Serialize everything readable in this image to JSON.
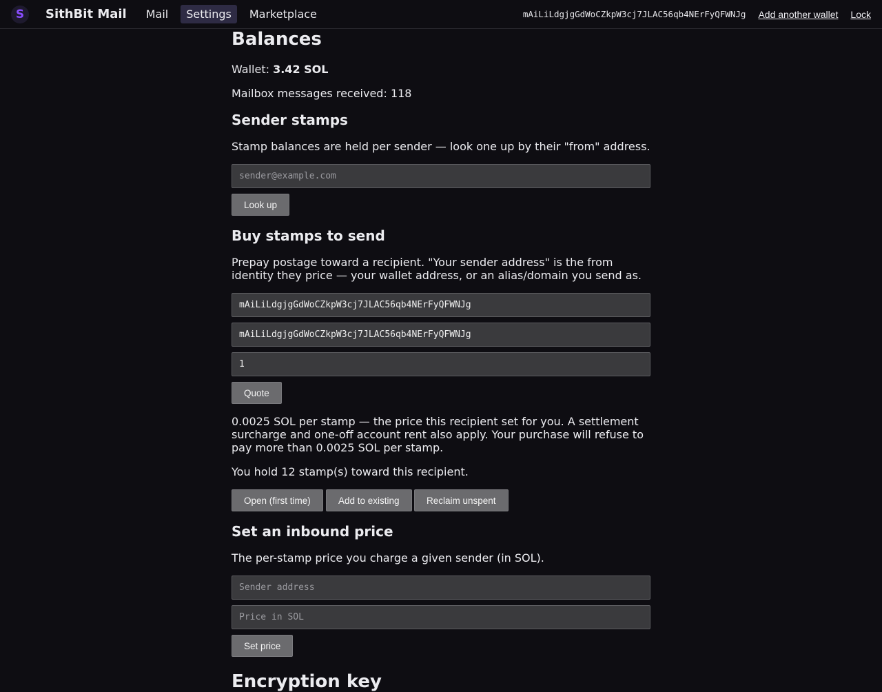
{
  "header": {
    "logo_letter": "S",
    "brand": "SithBit Mail",
    "nav": [
      "Mail",
      "Settings",
      "Marketplace"
    ],
    "wallet_address": "mAiLiLdgjgGdWoCZkpW3cj7JLAC56qb4NErFyQFWNJg",
    "add_wallet_label": "Add another wallet",
    "lock_label": "Lock"
  },
  "balances": {
    "heading": "Balances",
    "wallet_label": "Wallet: ",
    "wallet_value": "3.42 SOL",
    "mailbox_text": "Mailbox messages received: 118"
  },
  "sender_stamps": {
    "heading": "Sender stamps",
    "description": "Stamp balances are held per sender — look one up by their \"from\" address.",
    "input_placeholder": "sender@example.com",
    "button": "Look up"
  },
  "buy_stamps": {
    "heading": "Buy stamps to send",
    "description": "Prepay postage toward a recipient. \"Your sender address\" is the from identity they price — your wallet address, or an alias/domain you send as.",
    "recipient_value": "mAiLiLdgjgGdWoCZkpW3cj7JLAC56qb4NErFyQFWNJg",
    "sender_value": "mAiLiLdgjgGdWoCZkpW3cj7JLAC56qb4NErFyQFWNJg",
    "quantity_value": "1",
    "quote_button": "Quote",
    "quote_text": "0.0025 SOL per stamp — the price this recipient set for you. A settlement surcharge and one-off account rent also apply. Your purchase will refuse to pay more than 0.0025 SOL per stamp.",
    "hold_text": "You hold 12 stamp(s) toward this recipient.",
    "buttons": [
      "Open (first time)",
      "Add to existing",
      "Reclaim unspent"
    ]
  },
  "inbound_price": {
    "heading": "Set an inbound price",
    "description": "The per-stamp price you charge a given sender (in SOL).",
    "sender_placeholder": "Sender address",
    "price_placeholder": "Price in SOL",
    "button": "Set price"
  },
  "encryption": {
    "heading": "Encryption key"
  }
}
